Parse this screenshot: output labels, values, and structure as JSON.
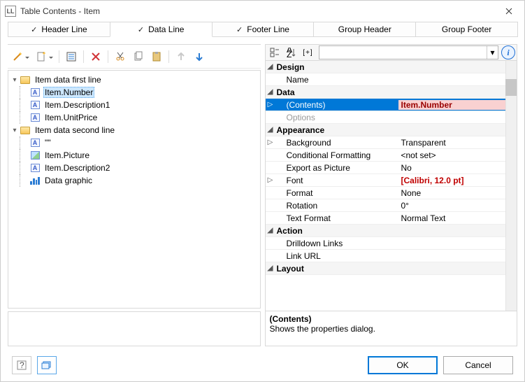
{
  "window": {
    "title": "Table Contents - Item"
  },
  "tabs": [
    {
      "label": "Header Line",
      "checked": true,
      "active": false
    },
    {
      "label": "Data Line",
      "checked": true,
      "active": true
    },
    {
      "label": "Footer Line",
      "checked": true,
      "active": false
    },
    {
      "label": "Group Header",
      "checked": false,
      "active": false
    },
    {
      "label": "Group Footer",
      "checked": false,
      "active": false
    }
  ],
  "tree": {
    "groups": [
      {
        "label": "Item data first line",
        "items": [
          {
            "icon": "A",
            "label": "Item.Number",
            "selected": true
          },
          {
            "icon": "A",
            "label": "Item.Description1"
          },
          {
            "icon": "A",
            "label": "Item.UnitPrice"
          }
        ]
      },
      {
        "label": "Item data second line",
        "items": [
          {
            "icon": "A",
            "label": "\"\""
          },
          {
            "icon": "pic",
            "label": "Item.Picture"
          },
          {
            "icon": "A",
            "label": "Item.Description2"
          },
          {
            "icon": "bars",
            "label": "Data graphic"
          }
        ]
      }
    ]
  },
  "props": {
    "categories": [
      {
        "name": "Design",
        "rows": [
          {
            "name": "Name",
            "value": ""
          }
        ]
      },
      {
        "name": "Data",
        "rows": [
          {
            "name": "(Contents)",
            "value": "Item.Number",
            "selected": true,
            "expandable": true
          },
          {
            "name": "Options",
            "value": ""
          }
        ]
      },
      {
        "name": "Appearance",
        "rows": [
          {
            "name": "Background",
            "value": "Transparent",
            "expandable": true
          },
          {
            "name": "Conditional Formatting",
            "value": "<not set>"
          },
          {
            "name": "Export as Picture",
            "value": "No"
          },
          {
            "name": "Font",
            "value": "[Calibri, 12.0 pt]",
            "red": true,
            "expandable": true
          },
          {
            "name": "Format",
            "value": "None"
          },
          {
            "name": "Rotation",
            "value": "0°"
          },
          {
            "name": "Text Format",
            "value": "Normal Text"
          }
        ]
      },
      {
        "name": "Action",
        "rows": [
          {
            "name": "Drilldown Links",
            "value": ""
          },
          {
            "name": "Link URL",
            "value": ""
          }
        ]
      },
      {
        "name": "Layout",
        "rows": []
      }
    ],
    "search_placeholder": ""
  },
  "desc": {
    "heading": "(Contents)",
    "body": "Shows the properties dialog."
  },
  "buttons": {
    "ok": "OK",
    "cancel": "Cancel"
  },
  "toolbar_hint": "[+]"
}
